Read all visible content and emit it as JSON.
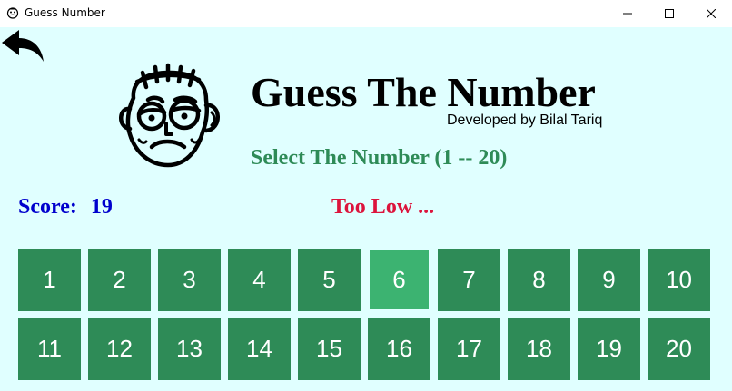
{
  "window": {
    "title": "Guess Number",
    "icon": "smiley-face-icon",
    "controls": [
      "minimize-icon",
      "maximize-icon",
      "close-icon"
    ]
  },
  "header": {
    "back_icon": "back-arrow-icon",
    "logo_icon": "grumpy-face-icon",
    "title": "Guess The Number",
    "developer": "Developed by Bilal Tariq",
    "instruction": "Select The Number (1 -- 20)"
  },
  "status": {
    "score_label": "Score:",
    "score_value": "19",
    "feedback": "Too Low ..."
  },
  "number_buttons": [
    "1",
    "2",
    "3",
    "4",
    "5",
    "6",
    "7",
    "8",
    "9",
    "10",
    "11",
    "12",
    "13",
    "14",
    "15",
    "16",
    "17",
    "18",
    "19",
    "20"
  ],
  "selected_number": "6",
  "colors": {
    "background": "#e0ffff",
    "button": "#2e8b57",
    "button_selected": "#3cb371",
    "instruction": "#2e8b57",
    "score": "#0000cd",
    "feedback": "#dc143c"
  }
}
